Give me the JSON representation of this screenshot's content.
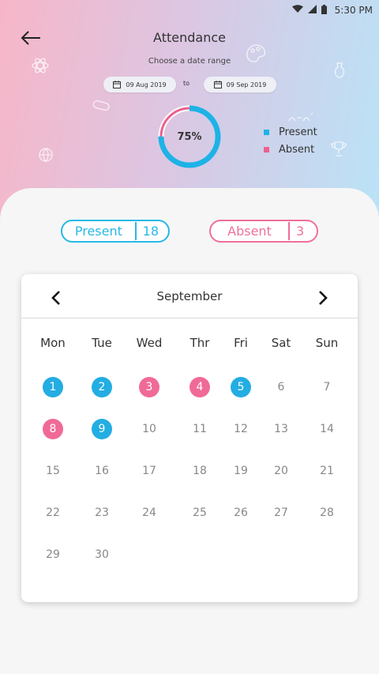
{
  "status_bar": {
    "time": "5:30 PM",
    "icons": [
      "wifi-icon",
      "signal-icon",
      "battery-icon"
    ]
  },
  "header": {
    "title": "Attendance",
    "subtitle": "Choose a date range",
    "date_from": "09 Aug 2019",
    "date_to": "09 Sep 2019",
    "to_label": "to"
  },
  "summary": {
    "percent_label": "75%",
    "percent_value": 0.75,
    "legend": [
      {
        "label": "Present",
        "color": "#1fb2e6"
      },
      {
        "label": "Absent",
        "color": "#ee5f8f"
      }
    ]
  },
  "counts": {
    "present_label": "Present",
    "present_count": "18",
    "absent_label": "Absent",
    "absent_count": "3"
  },
  "calendar": {
    "month": "September",
    "weekdays": [
      "Mon",
      "Tue",
      "Wed",
      "Thr",
      "Fri",
      "Sat",
      "Sun"
    ],
    "weeks": [
      [
        {
          "d": "1",
          "s": "present"
        },
        {
          "d": "2",
          "s": "present"
        },
        {
          "d": "3",
          "s": "absent"
        },
        {
          "d": "4",
          "s": "absent"
        },
        {
          "d": "5",
          "s": "present"
        },
        {
          "d": "6",
          "s": ""
        },
        {
          "d": "7",
          "s": ""
        }
      ],
      [
        {
          "d": "8",
          "s": "absent"
        },
        {
          "d": "9",
          "s": "present"
        },
        {
          "d": "10",
          "s": ""
        },
        {
          "d": "11",
          "s": ""
        },
        {
          "d": "12",
          "s": ""
        },
        {
          "d": "13",
          "s": ""
        },
        {
          "d": "14",
          "s": ""
        }
      ],
      [
        {
          "d": "15",
          "s": ""
        },
        {
          "d": "16",
          "s": ""
        },
        {
          "d": "17",
          "s": ""
        },
        {
          "d": "18",
          "s": ""
        },
        {
          "d": "19",
          "s": ""
        },
        {
          "d": "20",
          "s": ""
        },
        {
          "d": "21",
          "s": ""
        }
      ],
      [
        {
          "d": "22",
          "s": ""
        },
        {
          "d": "23",
          "s": ""
        },
        {
          "d": "24",
          "s": ""
        },
        {
          "d": "25",
          "s": ""
        },
        {
          "d": "26",
          "s": ""
        },
        {
          "d": "27",
          "s": ""
        },
        {
          "d": "28",
          "s": ""
        }
      ],
      [
        {
          "d": "29",
          "s": ""
        },
        {
          "d": "30",
          "s": ""
        }
      ]
    ]
  },
  "colors": {
    "present": "#23ade2",
    "absent": "#f06a97"
  }
}
